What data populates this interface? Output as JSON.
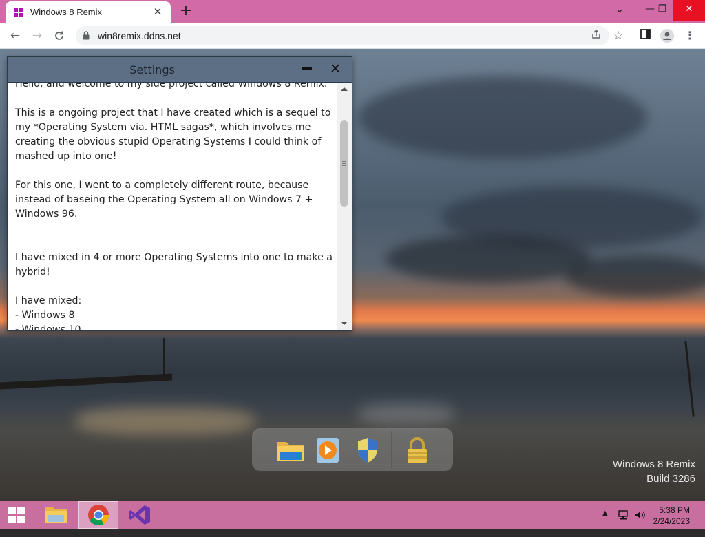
{
  "browser": {
    "tab_title": "Windows 8 Remix",
    "tab_close": "✕",
    "new_tab": "+",
    "url": "win8remix.ddns.net",
    "window_controls": {
      "chevron": "⌄",
      "minimize": "—",
      "restore": "❐",
      "close": "✕"
    }
  },
  "settings_window": {
    "title": "Settings",
    "close_glyph": "✕",
    "body": "Hello, and welcome to my side project called Windows 8 Remix.\n\nThis is a ongoing project that I have created which is a sequel to my *Operating System via. HTML sagas*, which involves me creating the obvious stupid Operating Systems I could think of mashed up into one!\n\nFor this one, I went to a completely different route, because instead of baseing the Operating System all on Windows 7 + Windows 96.\n\n\nI have mixed in 4 or more Operating Systems into one to make a hybrid!\n\nI have mixed:\n- Windows 8\n- Windows 10"
  },
  "desktop": {
    "watermark_line1": "Windows 8 Remix",
    "watermark_line2": "Build 3286",
    "dock_items": [
      "file-explorer",
      "media-player",
      "security-center",
      "lock"
    ]
  },
  "taskbar": {
    "items": [
      "start",
      "file-explorer",
      "chrome",
      "visual-studio"
    ],
    "active_item": "chrome",
    "time": "5:38 PM",
    "date": "2/24/2023"
  },
  "colors": {
    "tabstrip": "#d16aa6",
    "taskbar": "#c96fa0",
    "window_titlebar": "#5d6f84"
  }
}
